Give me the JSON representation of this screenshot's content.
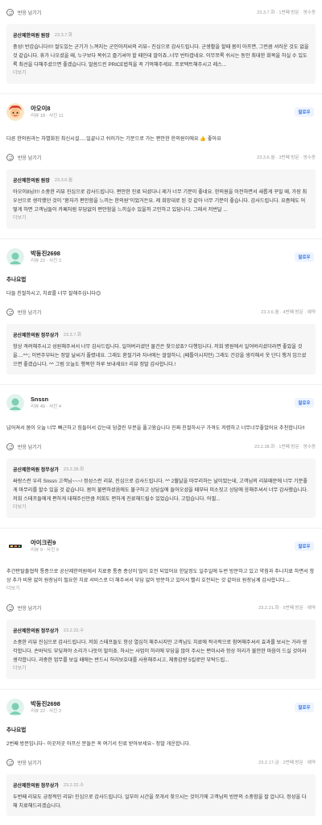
{
  "colors": {
    "accent": "#3578e5",
    "reply_bg": "#f6f6f7",
    "muted": "#9a9a9a"
  },
  "common": {
    "helpful_label": "반응 남기기",
    "follow_label": "팔로우",
    "more_label": "더보기",
    "owner_name": "공산제한의원 정무상가",
    "owner_name_alt": "공산제한의원 원장"
  },
  "reviews": [
    {
      "visit": "23.3.7.화 · 1번째 방문 · 영수증",
      "reply_owner": "공산제한의원 원장",
      "reply_date": "23.3.7.화",
      "reply_text": "충성! 반갑습니다!!!! 절도있는 군기가 느껴지는 군인아저씨의 리뷰~ 진심으로 감사드립니다. 군생활을 할때 몸이 아프면, 그런큼 서러운 것도 없을 것 같습니다. 휴가 나오셨을 때, 누구보다 목쉬고 즐기셔야 할 때인데 말이죠..너무 반타깝네요. 이무쪼록 쉬시는 동안 최대한 회복을 하실 수 있도록 최선을 다해주셨으면 좋겠습니다. 말씀드린 PRICE법칙을 꼭 기억해주세요. 프로텍트해주시고 레스...",
      "reply_more": "더보기"
    },
    {
      "nick": "아오이8",
      "stats": "리뷰 18 · 사진 11",
      "body": "다른 한의원과는 차별화된 최신시설.....일끝나고 쉬러가는 기분으로 가는 편안한 한의원이에요 👍 좋아요",
      "visit": "23.3.6.월 · 3번째 방문 · 영수증",
      "reply_owner": "공산제한의원 원장",
      "reply_date": "23.3.6.월",
      "reply_text": "아오이8님!!!! 소중한 리뷰 진심으로 감사드립니다. 편안한 진료 되셨다니 제가 너무 기분이 좋네요. 한의원을 이전하면서 새롭게 꾸밀 때, 가장 최우선으로 생각했던 것이 \"환자가 편안함을 느끼는 한의원\"이었거든요. 제 희망대로 된 것 같아 너무 기분이 좋습니다. 감사드립니다. 요즘에도 어떻게 하면 고객님들이 카페처럼 부담없이 편안함을 느끼실수 있을까 고민하고 있답니다. 그래서 저번달 ...",
      "reply_more": "더보기"
    },
    {
      "nick": "박동진2698",
      "stats": "리뷰 22 · 사진 3",
      "tag": "추나요법",
      "body": "다들 친절하시고, 치료를 너무 잘해주십니다😊",
      "visit": "23.3.6.월 · 4번째 방문 · 예약",
      "reply_owner": "공산제한의원 정무상가",
      "reply_date": "23.3.7.화",
      "reply_text": "항상 격려해주시고 성원해주셔서 너무 감사드립니다. 일어버리셨던 물건은 찾으셨죠? 다행입니다. 저희 병원에서 일어버리셨더라면 좋았을 것을....^^;; 이번주부터는 정말 날씨가 풀렸네요. 그래도 환절기라 자녀에는 쌀쌀하니, (페틀이시지만) 그래도 건강을 생각해서 옷 단디 챙겨 입으셨으면 좋겠습니다. ^^ 그럼 오늘도 행복한 하루 보내세요!! 리뷰 정말 감사합니다.!",
      "reply_more": ""
    },
    {
      "nick": "Snssn",
      "stats": "리뷰 49 · 사진 4",
      "body": "넘어져서 몸이 오늘 너무 뻐근하고 힘들어서 갔는데 덤결린 부분을 풀고왔습니다 진짜 친절하시구 가격도 저렴하고 너무너무좋았어요 추천합니다!!",
      "visit": "23.2.28.화 · 1번째 방문 · 영수증",
      "reply_owner": "공산제한의원 정무상가",
      "reply_date": "23.2.28.화",
      "reply_text": "싸랑스런 우리 Snssn 고객님~~~! 정성스런 리뷰, 진심으로 감사드립니다. ^^ 2월달을 마무리하는 날이었는데, 고객님의 리뷰때문에 너무 기분좋게 마무리를 할수 있을 것 같습니다. 몸이 불편하셨음에도 불구하고 상담실에 들어오셨을 때부터 미소짓고 상담에 응해주셔서 너무 감사했습니다. 저희 스태프들에게 편하게 대해주신만큼 저희도 편하게 진료해드릴수 있었습니다. 고맙습니다. 어필...",
      "reply_more": "더보기"
    },
    {
      "nick": "아이크린9",
      "stats": "리뷰 9 · 사진 9",
      "body": "추간판탈출협착 통증으로 공산제한의원에서 치료중 통증 증상이 많이 호전 되었어요 한달정도 일주일에 두번 방문하고 있고 약침과 추나치료 하면서 항상 추가 비용 없이 원장님이 필요한 치료 서비스로 더 해주셔서 부담 없이 방문하고 있어서 빨리 호전되는 것 같아요 원장님께 감사합니다....",
      "body_more": "더보기",
      "visit": "23.2.21.화 · 5번째 방문 · 예약",
      "reply_owner": "공산제한의원 정무상가",
      "reply_date": "23.2.22.수",
      "reply_text": "소중한 리뷰 진심으로 감사드립니다. 저희 스태프들도 항상 열심히 해주시지만 고객님도 치료에 적극적으로 참여해주셔서 효과를 보시는 거라 생각합니다. 손바닥도 부딪쳐야 소리가 나듯이 말이죠. 하시는 사업이 허리에 부담을 많이 주시는 편이시라 항상 허리가 불안한 마음이 드실 것이라 생각합니다. 과중한 업무를 보실 때에는 반드시 허리보호대를 사용해주시고, 체중감량 5킬로만 부탁드립...",
      "reply_more": "더보기"
    },
    {
      "nick": "박동진2698",
      "stats": "리뷰 22 · 사진 3",
      "tag": "추나요법",
      "body": "2번째 방문입니다~ 이곳저곳 아프신 분들은 꼭 여기서 진료 받아보세요~ 정말 개운합니다.",
      "visit": "23.2.17.금 · 2번째 방문 · 예약",
      "reply_owner": "공산제한의원 정무상가",
      "reply_date": "23.2.22.수",
      "reply_text": "두번째 리뷰도 긍정적인 리뷰! 진심으로 감사드립니다. 일부러 시간을 쪼개서 찾으시는 것이기에 고객님의 방문의 소중함을 잘 압니다. 정성을 다해 치료해드리겠습니다."
    }
  ]
}
